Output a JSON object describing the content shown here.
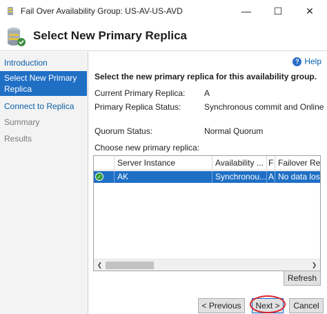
{
  "window": {
    "title": "Fail Over Availability Group: US-AV-US-AVD",
    "minimize_glyph": "—",
    "maximize_glyph": "☐",
    "close_glyph": "✕"
  },
  "header": {
    "title": "Select New Primary Replica",
    "icon": "database-wizard-icon"
  },
  "nav": {
    "items": [
      {
        "label": "Introduction",
        "state": "link"
      },
      {
        "label": "Select New Primary Replica",
        "state": "active"
      },
      {
        "label": "Connect to Replica",
        "state": "link"
      },
      {
        "label": "Summary",
        "state": "disabled"
      },
      {
        "label": "Results",
        "state": "disabled"
      }
    ]
  },
  "main": {
    "help_label": "Help",
    "instruction": "Select the new primary replica for this availability group.",
    "fields": {
      "current_primary_label": "Current Primary Replica:",
      "current_primary_value": "A",
      "status_label": "Primary Replica Status:",
      "status_value": "Synchronous commit and Online",
      "quorum_label": "Quorum Status:",
      "quorum_value": "Normal Quorum"
    },
    "choose_label": "Choose new primary replica:",
    "grid": {
      "columns": [
        "Server Instance",
        "Availability ...",
        "F",
        "Failover Rea"
      ],
      "rows": [
        {
          "server_instance": "AK",
          "availability": "Synchronou...",
          "f": "A",
          "failover": "No data los"
        }
      ],
      "scroll_left_glyph": "❮",
      "scroll_right_glyph": "❯"
    },
    "buttons": {
      "refresh": "Refresh",
      "previous": "< Previous",
      "next": "Next >",
      "cancel": "Cancel"
    }
  },
  "colors": {
    "selection_blue": "#1f6fc5",
    "link_blue": "#0a5fa8",
    "highlight_red": "#d8242a"
  }
}
